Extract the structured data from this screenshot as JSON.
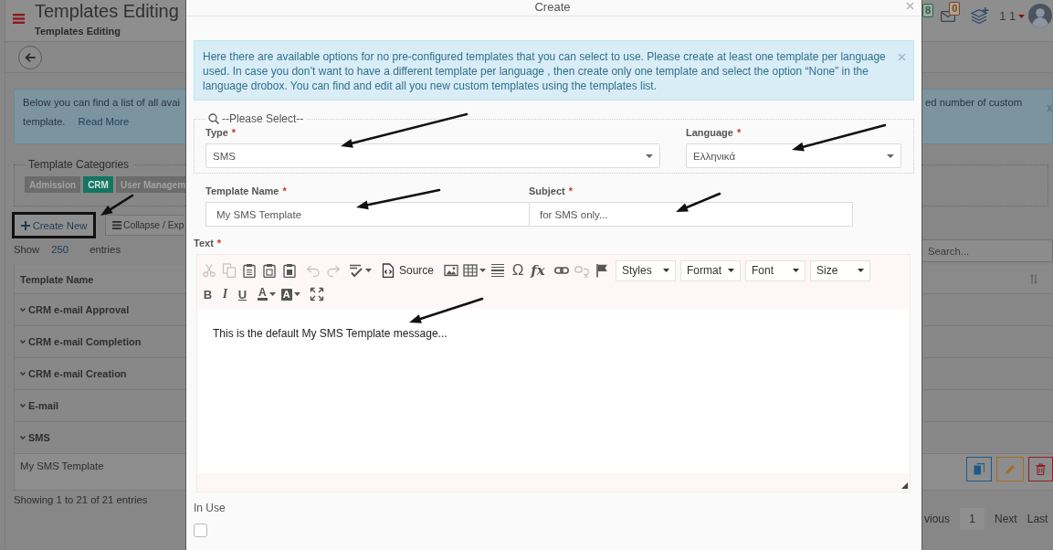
{
  "header": {
    "title": "Templates Editing",
    "subtitle": "Templates Editing",
    "badges": [
      {
        "kind": "plain",
        "count": "8",
        "color": "#1f6b45"
      },
      {
        "kind": "mail",
        "count": "0",
        "color": "#8a4308"
      }
    ],
    "user": "1 1"
  },
  "info_banner": {
    "left_lines": [
      "Below you can find a list of all avai",
      "template."
    ],
    "link": "Read More",
    "right_lines": [
      "ed number of custom"
    ]
  },
  "categories": {
    "legend": "Template Categories",
    "tags": [
      {
        "label": "Admission",
        "selected": false
      },
      {
        "label": "CRM",
        "selected": true
      },
      {
        "label": "User Managem",
        "selected": false
      }
    ]
  },
  "actions": [
    {
      "kind": "create",
      "label": "Create New",
      "framed": true,
      "arrow": true
    },
    {
      "kind": "collapse",
      "label": "Collapse / Exp",
      "framed": false,
      "arrow": false
    }
  ],
  "length_menu": {
    "before": "Show",
    "value": "250",
    "after": "entries"
  },
  "search": {
    "placeholder": "Search..."
  },
  "table": {
    "columns": [
      "Template Name"
    ],
    "rows": [
      {
        "kind": "group",
        "label": "CRM e-mail Approval"
      },
      {
        "kind": "group",
        "label": "CRM e-mail Completion"
      },
      {
        "kind": "group",
        "label": "CRM e-mail Creation"
      },
      {
        "kind": "group",
        "label": "E-mail"
      },
      {
        "kind": "group",
        "label": "SMS"
      },
      {
        "kind": "item",
        "label": "My SMS Template"
      }
    ],
    "info": "Showing 1 to 21 of 21 entries"
  },
  "pagination": [
    {
      "label": "vious",
      "selected": false
    },
    {
      "label": "1",
      "selected": true
    },
    {
      "label": "Next",
      "selected": false
    },
    {
      "label": "Last",
      "selected": false
    }
  ],
  "modal": {
    "title": "Create",
    "alert": "Here there are available options for no pre-configured templates that you can select to use. Please create at least one template per language used. In case you don’t want to have a different template per language , then create only one template and select the option “None” in the language drobox. You can find and edit all you new custom templates using the templates list.",
    "selector": {
      "legend": "--Please Select--",
      "fields": [
        {
          "label": "Type",
          "mark": "*",
          "value": "SMS",
          "arrow": true
        },
        {
          "label": "Language",
          "mark": "*",
          "value": "Ελληνικά",
          "arrow": true
        }
      ]
    },
    "inputs": [
      {
        "label": "Template Name",
        "mark": "*",
        "value": "My SMS Template",
        "arrow": true
      },
      {
        "label": "Subject",
        "mark": "*",
        "value": "for SMS only...",
        "arrow": true
      }
    ],
    "editor": {
      "label": "Text",
      "mark": "*",
      "arrow": true,
      "content": "This is the default My SMS Template message...",
      "toolbar": [
        {
          "groups": [
            [
              {
                "kind": "cut",
                "disabled": true
              },
              {
                "kind": "copy",
                "disabled": true
              },
              {
                "kind": "paste",
                "disabled": false
              },
              {
                "kind": "paste-text",
                "disabled": false
              },
              {
                "kind": "paste-word",
                "disabled": false
              }
            ],
            [
              {
                "kind": "undo",
                "disabled": true
              },
              {
                "kind": "redo",
                "disabled": true
              }
            ],
            [
              {
                "kind": "spellcheck",
                "disabled": false
              }
            ],
            [
              {
                "kind": "source",
                "label": "Source",
                "disabled": false
              }
            ],
            [
              {
                "kind": "image",
                "disabled": false
              },
              {
                "kind": "table",
                "disabled": false
              },
              {
                "kind": "hline",
                "disabled": false
              },
              {
                "kind": "symbol",
                "label": "Ω",
                "disabled": false
              },
              {
                "kind": "formula",
                "label": "fx",
                "disabled": false
              }
            ],
            [
              {
                "kind": "link",
                "disabled": false
              },
              {
                "kind": "unlink",
                "disabled": true
              },
              {
                "kind": "anchor",
                "disabled": false
              }
            ],
            [
              {
                "kind": "combo",
                "label": "Styles",
                "disabled": false
              },
              {
                "kind": "combo",
                "label": "Format",
                "disabled": false
              },
              {
                "kind": "combo",
                "label": "Font",
                "disabled": false
              },
              {
                "kind": "combo",
                "label": "Size",
                "disabled": false
              }
            ]
          ]
        },
        {
          "groups": [
            [
              {
                "kind": "bold",
                "label": "B",
                "disabled": false
              },
              {
                "kind": "italic",
                "label": "I",
                "disabled": false
              },
              {
                "kind": "underline",
                "label": "U",
                "disabled": false
              }
            ],
            [
              {
                "kind": "text-color",
                "label": "A",
                "disabled": false
              },
              {
                "kind": "bg-color",
                "label": "A",
                "disabled": false
              }
            ],
            [
              {
                "kind": "maximize",
                "disabled": false
              }
            ]
          ]
        }
      ]
    },
    "in_use": {
      "label": "In Use",
      "checked": false
    }
  }
}
